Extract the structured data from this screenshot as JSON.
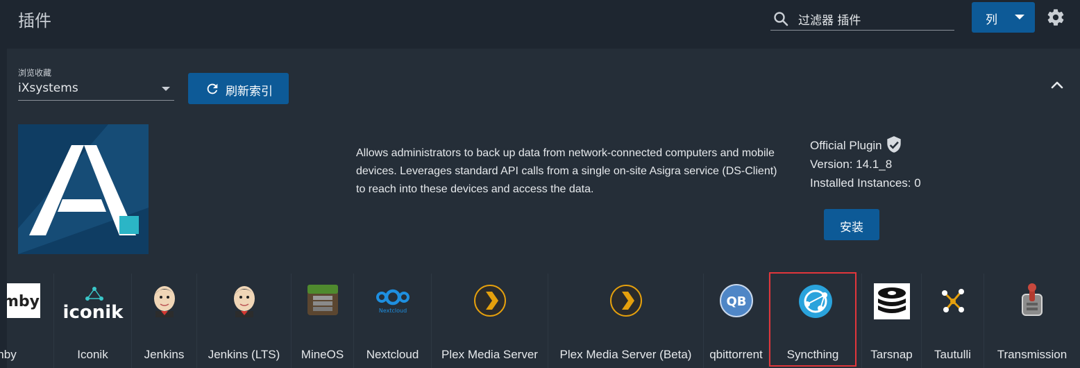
{
  "header": {
    "title": "插件",
    "search_placeholder": "过滤器 插件",
    "search_value": "过滤器 插件",
    "columns_label": "列"
  },
  "repo": {
    "label": "浏览收藏",
    "selected": "iXsystems",
    "refresh_label": "刷新索引"
  },
  "plugin": {
    "logo_letter": "A.",
    "description": "Allows administrators to back up data from network-connected computers and mobile devices. Leverages standard API calls from a single on-site Asigra service (DS-Client) to reach into these devices and access the data.",
    "official_label": "Official Plugin",
    "version": "Version: 14.1_8",
    "instances": "Installed Instances: 0",
    "install_label": "安装"
  },
  "tiles": [
    {
      "name": "nby",
      "icon": "emby-icon",
      "logo_text": "mby"
    },
    {
      "name": "Iconik",
      "icon": "iconik-icon",
      "logo_text": "iconik"
    },
    {
      "name": "Jenkins",
      "icon": "jenkins-icon"
    },
    {
      "name": "Jenkins (LTS)",
      "icon": "jenkins-icon"
    },
    {
      "name": "MineOS",
      "icon": "mineos-icon"
    },
    {
      "name": "Nextcloud",
      "icon": "nextcloud-icon",
      "logo_text": "Nextcloud"
    },
    {
      "name": "Plex Media Server",
      "icon": "plex-icon"
    },
    {
      "name": "Plex Media Server (Beta)",
      "icon": "plex-icon"
    },
    {
      "name": "qbittorrent",
      "icon": "qbittorrent-icon",
      "logo_text": "QB"
    },
    {
      "name": "Syncthing",
      "icon": "syncthing-icon"
    },
    {
      "name": "Tarsnap",
      "icon": "tarsnap-icon"
    },
    {
      "name": "Tautulli",
      "icon": "tautulli-icon"
    },
    {
      "name": "Transmission",
      "icon": "transmission-icon"
    }
  ],
  "colors": {
    "accent": "#0d5a97",
    "selection": "#e2363b",
    "background": "#1e2630",
    "panel": "#252e38"
  }
}
